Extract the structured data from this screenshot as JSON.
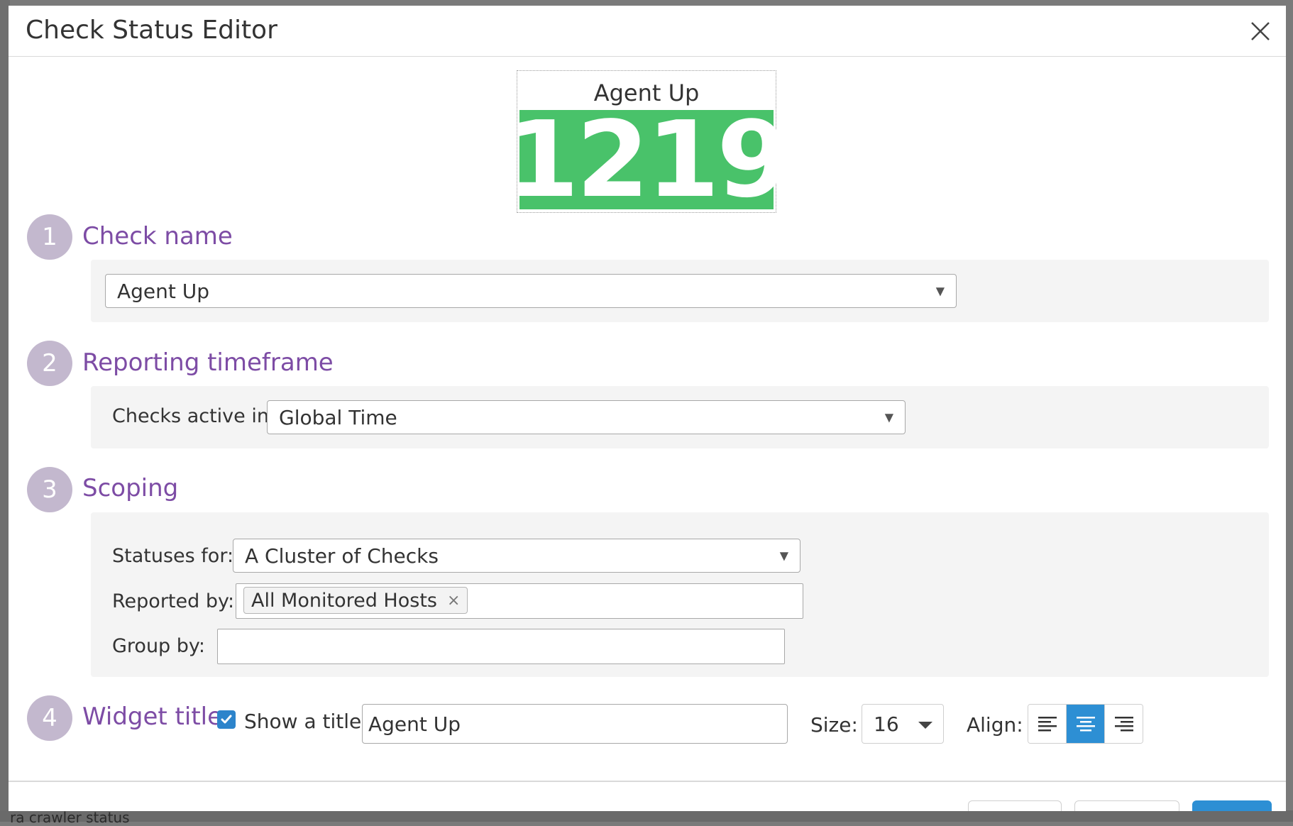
{
  "background": {
    "bottom_text": "ra crawler status"
  },
  "modal": {
    "title": "Check Status Editor"
  },
  "preview": {
    "title": "Agent Up",
    "value": "1219",
    "color": "#49c26a"
  },
  "steps": [
    {
      "number": "1",
      "title": "Check name"
    },
    {
      "number": "2",
      "title": "Reporting timeframe"
    },
    {
      "number": "3",
      "title": "Scoping"
    },
    {
      "number": "4",
      "title": "Widget title"
    }
  ],
  "check_name": {
    "selected": "Agent Up"
  },
  "timeframe": {
    "label": "Checks active in:",
    "selected": "Global Time"
  },
  "scoping": {
    "statuses_label": "Statuses for:",
    "statuses_selected": "A Cluster of Checks",
    "reported_label": "Reported by:",
    "reported_tag": "All Monitored Hosts",
    "group_label": "Group by:",
    "group_value": ""
  },
  "widget_title": {
    "show_label": "Show a title:",
    "checked": true,
    "title_value": "Agent Up",
    "size_label": "Size:",
    "size_value": "16",
    "align_label": "Align:",
    "align_options": [
      "left",
      "center",
      "right"
    ],
    "align_selected": "center"
  },
  "colors": {
    "accent": "#7d4ca5",
    "primary": "#2d8fd4",
    "step_circle": "#c3b8ce"
  }
}
